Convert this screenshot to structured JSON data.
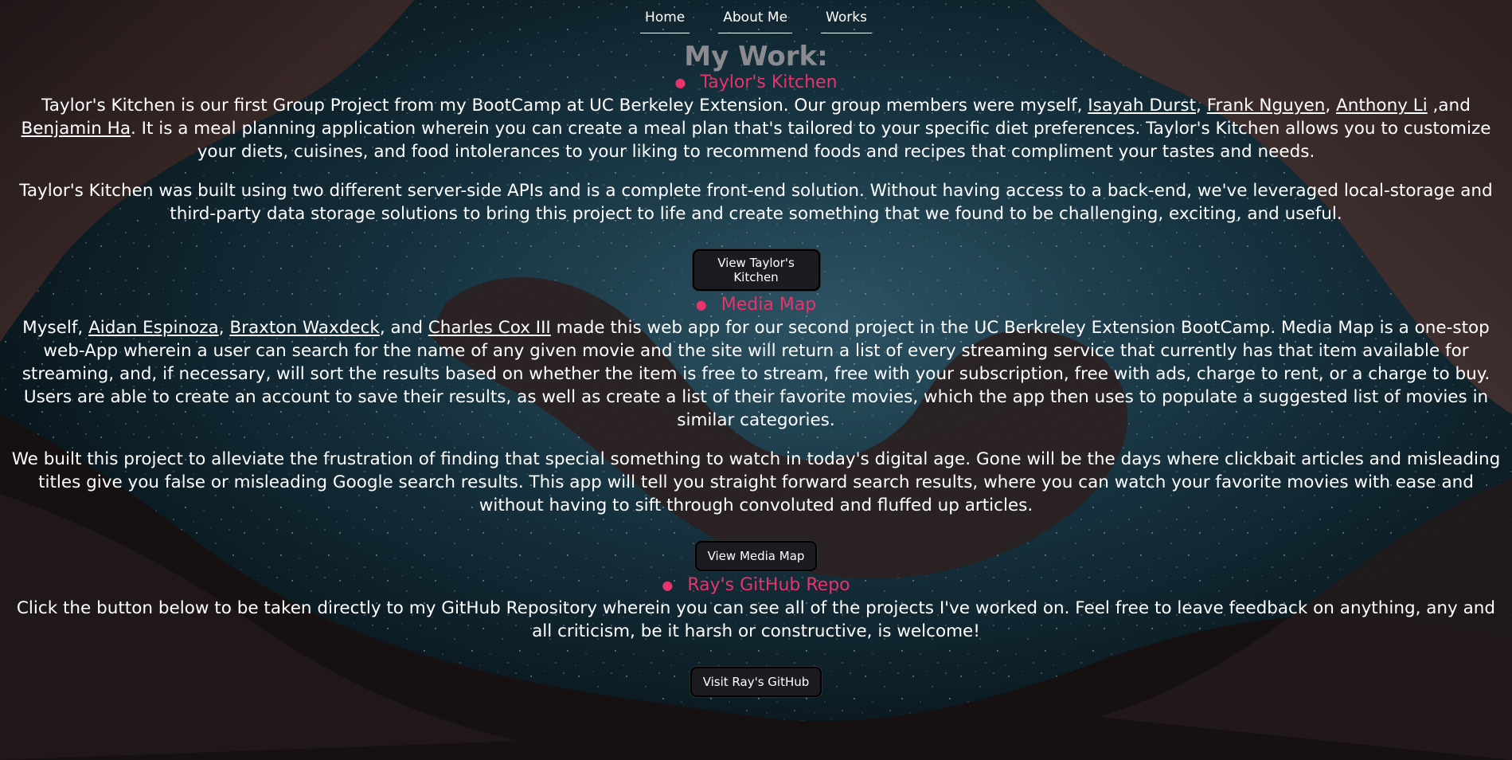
{
  "nav": {
    "items": [
      "Home",
      "About Me",
      "Works"
    ]
  },
  "page_title": "My Work:",
  "projects": [
    {
      "title": "Taylor's Kitchen",
      "p1_a": "Taylor's Kitchen is our first Group Project from my BootCamp at UC Berkeley Extension. Our group members were myself, ",
      "links": [
        "Isayah Durst",
        "Frank Nguyen",
        "Anthony Li",
        "Benjamin Ha"
      ],
      "sep1": ", ",
      "sep2": ", ",
      "sep3": " ,and ",
      "p1_b": ". It is a meal planning application wherein you can create a meal plan that's tailored to your specific diet preferences. Taylor's Kitchen allows you to customize your diets, cuisines, and food intolerances to your liking to recommend foods and recipes that compliment your tastes and needs.",
      "p2": "Taylor's Kitchen was built using two different server-side APIs and is a complete front-end solution. Without having access to a back-end, we've leveraged local-storage and third-party data storage solutions to bring this project to life and create something that we found to be challenging, exciting, and useful.",
      "button": "View Taylor's Kitchen"
    },
    {
      "title": "Media Map",
      "p1_a": "Myself, ",
      "links": [
        "Aidan Espinoza",
        "Braxton Waxdeck",
        "Charles Cox III"
      ],
      "sep1": ", ",
      "sep2": ", and ",
      "p1_b": " made this web app for our second project in the UC Berkreley Extension BootCamp. Media Map is a one-stop web-App wherein a user can search for the name of any given movie and the site will return a list of every streaming service that currently has that item available for streaming, and, if necessary, will sort the results based on whether the item is free to stream, free with your subscription, free with ads, charge to rent, or a charge to buy. Users are able to create an account to save their results, as well as create a list of their favorite movies, which the app then uses to populate a suggested list of movies in similar categories.",
      "p2": "We built this project to alleviate the frustration of finding that special something to watch in today's digital age. Gone will be the days where clickbait articles and misleading titles give you false or misleading Google search results. This app will tell you straight forward search results, where you can watch your favorite movies with ease and without having to sift through convoluted and fluffed up articles.",
      "button": "View Media Map"
    },
    {
      "title": "Ray's GitHub Repo",
      "p1": "Click the button below to be taken directly to my GitHub Repository wherein you can see all of the projects I've worked on. Feel free to leave feedback on anything, any and all criticism, be it harsh or constructive, is welcome!",
      "button": "Visit Ray's GitHub"
    }
  ],
  "colors": {
    "accent": "#e8336b",
    "title_gray": "#8a8a8f",
    "button_bg": "#1c1b1f"
  }
}
